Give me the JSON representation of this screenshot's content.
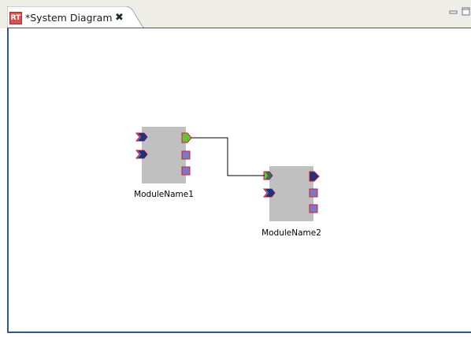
{
  "editor_tab": {
    "icon_text": "RT",
    "title": "*System Diagram",
    "close_glyph": "✖"
  },
  "view_controls": [
    "minimize-icon",
    "maximize-icon"
  ],
  "colors": {
    "module_body": "#c0c0c0",
    "port_fill": "#7b78c8",
    "port_border": "#d21c2c",
    "port_dark": "#22317a",
    "connected_port": "#6cbf3a",
    "editor_border": "#2f5a91"
  },
  "diagram": {
    "modules": [
      {
        "name": "ModuleName1",
        "data_in_ports": 2,
        "data_out_ports": 1,
        "service_ports": 2
      },
      {
        "name": "ModuleName2",
        "data_in_ports": 2,
        "data_out_ports": 1,
        "service_ports": 2
      }
    ],
    "connections": [
      {
        "from": "ModuleName1 out port",
        "to": "ModuleName2 in port 1"
      }
    ]
  }
}
